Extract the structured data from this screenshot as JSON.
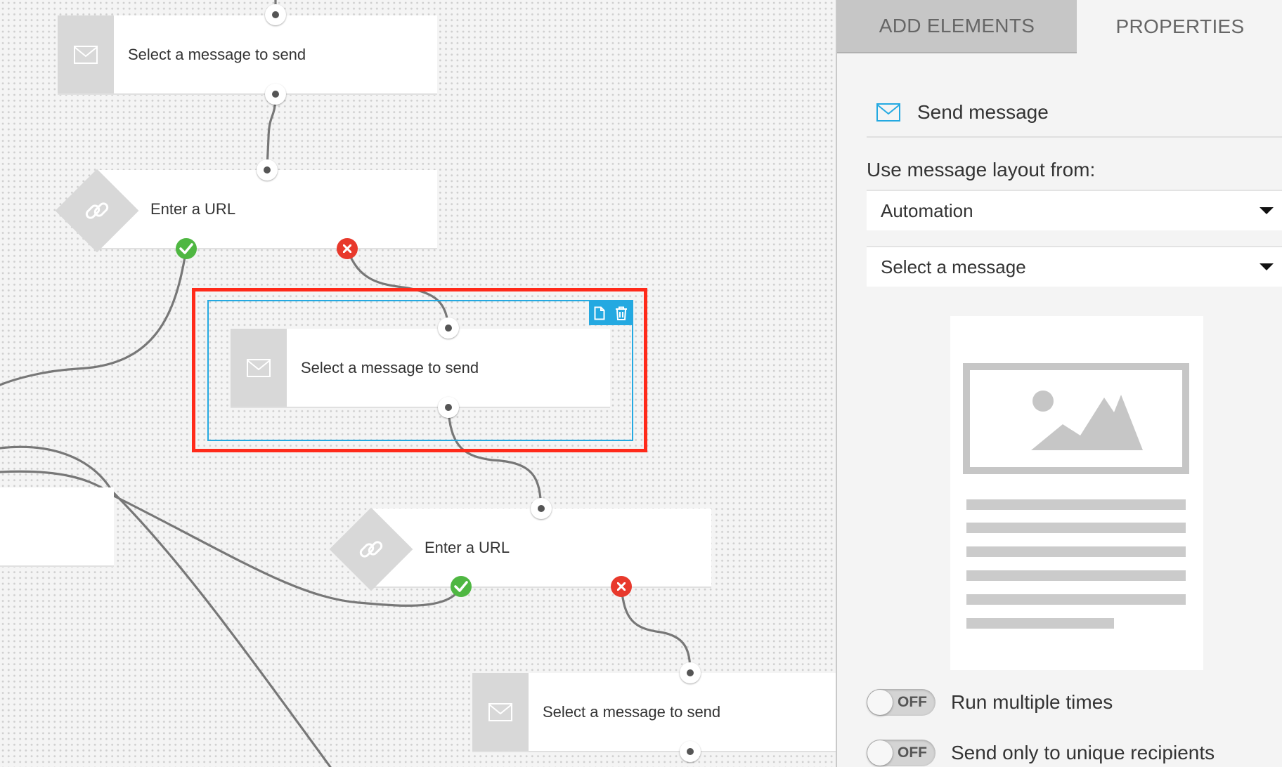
{
  "canvas": {
    "nodes": [
      {
        "type": "message",
        "label": "Select a message to send"
      },
      {
        "type": "url",
        "label": "Enter a URL"
      },
      {
        "type": "message",
        "label": "Select a message to send"
      },
      {
        "type": "url",
        "label": "Enter a URL"
      },
      {
        "type": "message",
        "label": "Select a message to send"
      }
    ],
    "selection_tools": [
      "copy-icon",
      "trash-icon"
    ]
  },
  "panel": {
    "tabs": [
      {
        "label": "ADD ELEMENTS",
        "active": true
      },
      {
        "label": "PROPERTIES",
        "active": false
      }
    ],
    "header": {
      "icon": "envelope-icon",
      "title": "Send message"
    },
    "layout_label": "Use message layout from:",
    "layout_select": {
      "value": "Automation"
    },
    "message_select": {
      "value": "Select a message"
    },
    "toggles": [
      {
        "state": "OFF",
        "label": "Run multiple times"
      },
      {
        "state": "OFF",
        "label": "Send only to unique recipients"
      }
    ]
  },
  "colors": {
    "accent": "#24a9e1",
    "highlight": "#ff2a1a",
    "success": "#4fb742",
    "failure": "#e8392c"
  }
}
